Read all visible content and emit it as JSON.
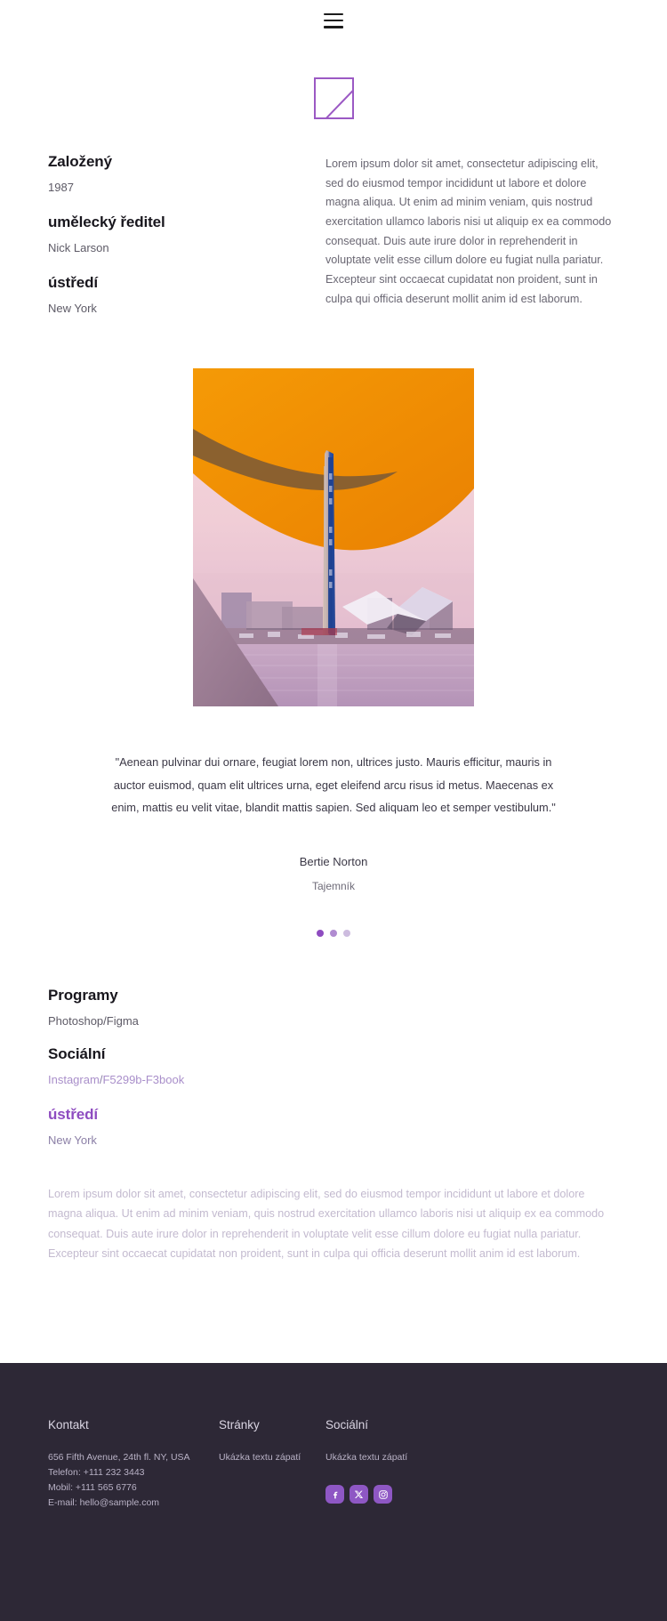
{
  "header": {
    "menu_icon": "hamburger-menu-icon"
  },
  "logo": {
    "icon": "image-placeholder-logo"
  },
  "intro": {
    "facts": [
      {
        "title": "Založený",
        "value": "1987"
      },
      {
        "title": "umělecký ředitel",
        "value": "Nick Larson"
      },
      {
        "title": "ústředí",
        "value": "New York"
      }
    ],
    "paragraph": "Lorem ipsum dolor sit amet, consectetur adipiscing elit, sed do eiusmod tempor incididunt ut labore et dolore magna aliqua. Ut enim ad minim veniam, quis nostrud exercitation ullamco laboris nisi ut aliquip ex ea commodo consequat. Duis aute irure dolor in reprehenderit in voluptate velit esse cillum dolore eu fugiat nulla pariatur. Excepteur sint occaecat cupidatat non proident, sunt in culpa qui officia deserunt mollit anim id est laborum."
  },
  "hero": {
    "alt": "orange-dune-over-pink-cityscape-image",
    "colors": {
      "orange": "#ef8f04",
      "dune_shadow": "#7a5a36",
      "sky_pink": "#f3d2d9",
      "water": "#c9a7c2",
      "tower_blue": "#2a53a8",
      "foreground_mauve": "#9d7f96"
    }
  },
  "testimonial": {
    "quote": "\"Aenean pulvinar dui ornare, feugiat lorem non, ultrices justo. Mauris efficitur, mauris in auctor euismod, quam elit ultrices urna, eget eleifend arcu risus id metus. Maecenas ex enim, mattis eu velit vitae, blandit mattis sapien. Sed aliquam leo et semper vestibulum.\"",
    "author": "Bertie Norton",
    "role": "Tajemník",
    "dots": [
      "active",
      "inactive",
      "inactive"
    ]
  },
  "facts2": {
    "programs_title": "Programy",
    "programs_value": "Photoshop/Figma",
    "social_title": "Sociální",
    "social_link_1": "Instagram",
    "social_separator": "/",
    "social_link_2": "F5299b-F3book",
    "hq_title": "ústředí",
    "hq_value": "New York"
  },
  "light_paragraph": "Lorem ipsum dolor sit amet, consectetur adipiscing elit, sed do eiusmod tempor incididunt ut labore et dolore magna aliqua. Ut enim ad minim veniam, quis nostrud exercitation ullamco laboris nisi ut aliquip ex ea commodo consequat. Duis aute irure dolor in reprehenderit in voluptate velit esse cillum dolore eu fugiat nulla pariatur. Excepteur sint occaecat cupidatat non proident, sunt in culpa qui officia deserunt mollit anim id est laborum.",
  "footer": {
    "background": "#2d2836",
    "accent": "#8e57c4",
    "contact": {
      "title": "Kontakt",
      "address": "656 Fifth Avenue, 24th fl. NY, USA",
      "phone": "Telefon: +111 232 3443",
      "mobile": "Mobil: +111 565 6776",
      "email": "E-mail: hello@sample.com"
    },
    "pages": {
      "title": "Stránky",
      "text": "Ukázka textu zápatí"
    },
    "social": {
      "title": "Sociální",
      "text": "Ukázka textu zápatí",
      "icons": [
        "facebook-icon",
        "x-twitter-icon",
        "instagram-icon"
      ]
    }
  }
}
